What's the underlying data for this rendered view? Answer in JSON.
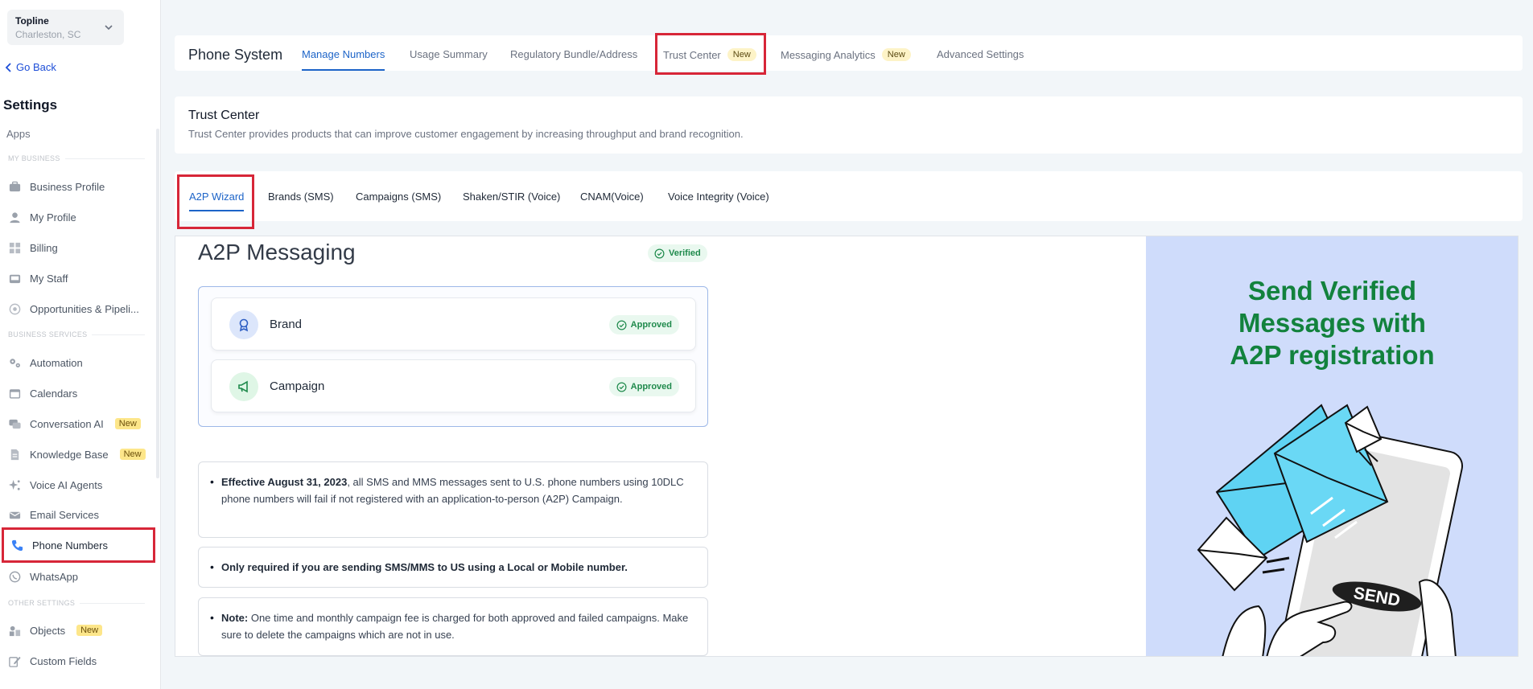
{
  "account": {
    "name": "Topline",
    "location": "Charleston, SC"
  },
  "sidebar": {
    "go_back": "Go Back",
    "settings_title": "Settings",
    "apps": "Apps",
    "sections": {
      "my_business": "MY BUSINESS",
      "business_services": "BUSINESS SERVICES",
      "other_settings": "OTHER SETTINGS"
    },
    "items": [
      {
        "label": "Business Profile",
        "icon": "briefcase-icon"
      },
      {
        "label": "My Profile",
        "icon": "user-icon"
      },
      {
        "label": "Billing",
        "icon": "grid-icon"
      },
      {
        "label": "My Staff",
        "icon": "inbox-icon"
      },
      {
        "label": "Opportunities & Pipeli...",
        "icon": "target-icon"
      },
      {
        "label": "Automation",
        "icon": "gears-icon"
      },
      {
        "label": "Calendars",
        "icon": "calendar-icon"
      },
      {
        "label": "Conversation AI",
        "icon": "chat-icon",
        "badge": "New"
      },
      {
        "label": "Knowledge Base",
        "icon": "document-icon",
        "badge": "New"
      },
      {
        "label": "Voice AI Agents",
        "icon": "sparkle-icon"
      },
      {
        "label": "Email Services",
        "icon": "mail-icon"
      },
      {
        "label": "Phone Numbers",
        "icon": "phone-icon"
      },
      {
        "label": "WhatsApp",
        "icon": "whatsapp-icon"
      },
      {
        "label": "Objects",
        "icon": "shapes-icon",
        "badge": "New"
      },
      {
        "label": "Custom Fields",
        "icon": "edit-icon"
      }
    ]
  },
  "topbar": {
    "title": "Phone System",
    "tabs": [
      {
        "label": "Manage Numbers"
      },
      {
        "label": "Usage Summary"
      },
      {
        "label": "Regulatory Bundle/Address"
      },
      {
        "label": "Trust Center",
        "badge": "New"
      },
      {
        "label": "Messaging Analytics",
        "badge": "New"
      },
      {
        "label": "Advanced Settings"
      }
    ]
  },
  "trust_center": {
    "title": "Trust Center",
    "description": "Trust Center provides products that can improve customer engagement by increasing throughput and brand recognition."
  },
  "subtabs": [
    {
      "label": "A2P Wizard"
    },
    {
      "label": "Brands (SMS)"
    },
    {
      "label": "Campaigns (SMS)"
    },
    {
      "label": "Shaken/STIR (Voice)"
    },
    {
      "label": "CNAM(Voice)"
    },
    {
      "label": "Voice Integrity (Voice)"
    }
  ],
  "a2p": {
    "title": "A2P Messaging",
    "verified": "Verified",
    "rows": [
      {
        "label": "Brand",
        "status": "Approved"
      },
      {
        "label": "Campaign",
        "status": "Approved"
      }
    ],
    "notes": [
      {
        "bold": "Effective August 31, 2023",
        "text": ", all SMS and MMS messages sent to U.S. phone numbers using 10DLC phone numbers will fail if not registered with an application-to-person (A2P) Campaign."
      },
      {
        "bold": "Only required if you are sending SMS/MMS to US using a Local or Mobile number.",
        "text": ""
      },
      {
        "bold": "Note:",
        "text": " One time and monthly campaign fee is charged for both approved and failed campaigns. Make sure to delete the campaigns which are not in use."
      }
    ]
  },
  "promo": {
    "line1": "Send Verified",
    "line2": "Messages with",
    "line3": "A2P registration",
    "send_label": "SEND"
  },
  "colors": {
    "accent": "#1d64c8",
    "highlight": "#d72638",
    "success": "#1f8a4c",
    "promo_bg": "#cfdcfb",
    "promo_text": "#12823d"
  }
}
